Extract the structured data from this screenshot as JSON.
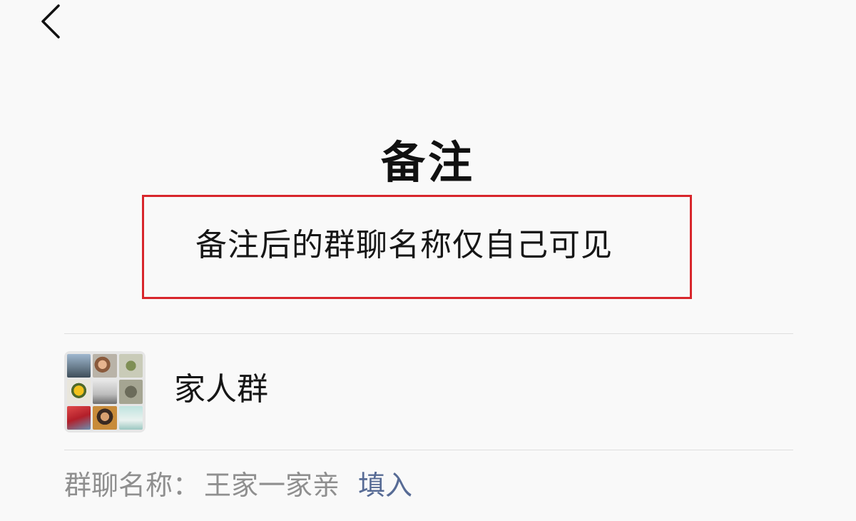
{
  "nav": {
    "back_icon": "chevron-left-icon"
  },
  "header": {
    "title": "备注"
  },
  "hint": {
    "text": "备注后的群聊名称仅自己可见",
    "highlight_color": "#d8262c"
  },
  "group": {
    "name": "家人群",
    "avatar_icon": "group-avatar-grid-icon"
  },
  "group_name_row": {
    "label": "群聊名称：",
    "value": "王家一家亲",
    "action": "填入",
    "action_color": "#576b95"
  }
}
